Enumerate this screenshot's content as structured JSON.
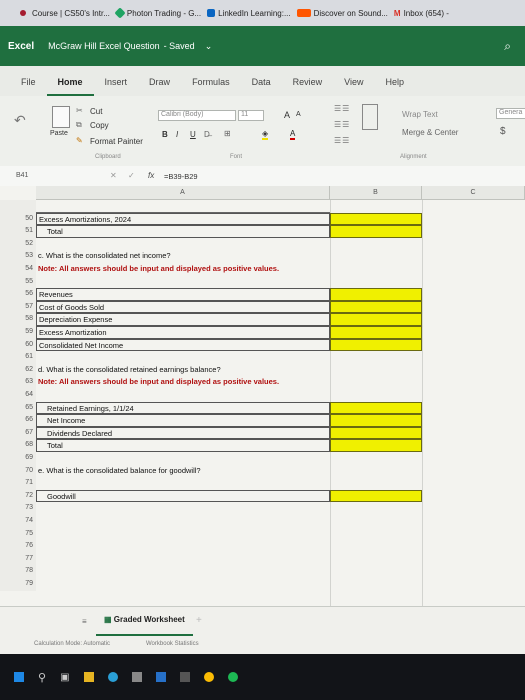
{
  "bookmarks": [
    {
      "label": "Course | CS50's Intr...",
      "icon": "harvard-icon",
      "color": "#a51c30"
    },
    {
      "label": "Photon Trading - G...",
      "icon": "google-drive-icon",
      "color": "#1fa463"
    },
    {
      "label": "LinkedIn Learning:...",
      "icon": "linkedin-icon",
      "color": "#0a66c2"
    },
    {
      "label": "Discover on Sound...",
      "icon": "soundcloud-icon",
      "color": "#ff5500"
    },
    {
      "label": "Inbox (654) -",
      "icon": "gmail-icon",
      "color": "#d93025"
    }
  ],
  "titlebar": {
    "app": "Excel",
    "doc": "McGraw Hill Excel Question",
    "saved": "- Saved",
    "chevron": "⌄",
    "brand_color": "#1f6f3f"
  },
  "menu": {
    "tabs": [
      "File",
      "Home",
      "Insert",
      "Draw",
      "Formulas",
      "Data",
      "Review",
      "View",
      "Help"
    ],
    "active": "Home"
  },
  "ribbon": {
    "undo": "↶",
    "paste": "Paste",
    "cut": "Cut",
    "copy": "Copy",
    "format_painter": "Format Painter",
    "clipboard": "Clipboard",
    "font_name": "Calibri (Body)",
    "font_size": "11",
    "grow": "A",
    "shrink": "A",
    "bold": "B",
    "italic": "I",
    "underline": "U",
    "font_group": "Font",
    "wrap_text": "Wrap Text",
    "merge_center": "Merge & Center",
    "alignment": "Alignment",
    "number_format": "Genera",
    "currency": "$"
  },
  "formula_bar": {
    "cell_ref": "B41",
    "fx": "fx",
    "formula": "=B39-B29"
  },
  "columns": [
    "A",
    "B",
    "C"
  ],
  "rows": [
    {
      "n": "",
      "a": "",
      "style": "partial"
    },
    {
      "n": "50",
      "a": "Excess Amortizations, 2024",
      "b": "yellow",
      "style": "boxed"
    },
    {
      "n": "51",
      "a": "Total",
      "b": "yellow",
      "style": "boxed-indent"
    },
    {
      "n": "52",
      "a": ""
    },
    {
      "n": "53",
      "a": "c. What is the consolidated net income?"
    },
    {
      "n": "54",
      "a": "Note: All answers should be input and displayed as positive values.",
      "style": "red"
    },
    {
      "n": "55",
      "a": ""
    },
    {
      "n": "56",
      "a": "Revenues",
      "b": "yellow",
      "style": "boxed"
    },
    {
      "n": "57",
      "a": "Cost of Goods Sold",
      "b": "yellow",
      "style": "boxed"
    },
    {
      "n": "58",
      "a": "Depreciation Expense",
      "b": "yellow",
      "style": "boxed"
    },
    {
      "n": "59",
      "a": "Excess Amortization",
      "b": "yellow",
      "style": "boxed"
    },
    {
      "n": "60",
      "a": "Consolidated Net Income",
      "b": "yellow",
      "style": "boxed"
    },
    {
      "n": "61",
      "a": ""
    },
    {
      "n": "62",
      "a": "d. What is the consolidated retained earnings balance?"
    },
    {
      "n": "63",
      "a": "Note: All answers should be input and displayed as positive values.",
      "style": "red"
    },
    {
      "n": "64",
      "a": ""
    },
    {
      "n": "65",
      "a": "Retained Earnings, 1/1/24",
      "b": "yellow",
      "style": "boxed-indent"
    },
    {
      "n": "66",
      "a": "Net Income",
      "b": "yellow",
      "style": "boxed-indent"
    },
    {
      "n": "67",
      "a": "Dividends Declared",
      "b": "yellow",
      "style": "boxed-indent"
    },
    {
      "n": "68",
      "a": "Total",
      "b": "yellow",
      "style": "boxed-indent"
    },
    {
      "n": "69",
      "a": ""
    },
    {
      "n": "70",
      "a": "e. What is the consolidated balance for goodwill?"
    },
    {
      "n": "71",
      "a": ""
    },
    {
      "n": "72",
      "a": "Goodwill",
      "b": "yellow",
      "style": "boxed-indent"
    },
    {
      "n": "73",
      "a": ""
    },
    {
      "n": "74",
      "a": ""
    },
    {
      "n": "75",
      "a": ""
    },
    {
      "n": "76",
      "a": ""
    },
    {
      "n": "77",
      "a": ""
    },
    {
      "n": "78",
      "a": ""
    },
    {
      "n": "79",
      "a": ""
    }
  ],
  "sheet": {
    "name": "Graded Worksheet",
    "add": "+"
  },
  "status": {
    "calc_mode": "Calculation Mode: Automatic",
    "stats": "Workbook Statistics"
  },
  "colors": {
    "yellow": "#f0f000",
    "note_red": "#b01010",
    "accent": "#1f6f3f"
  }
}
